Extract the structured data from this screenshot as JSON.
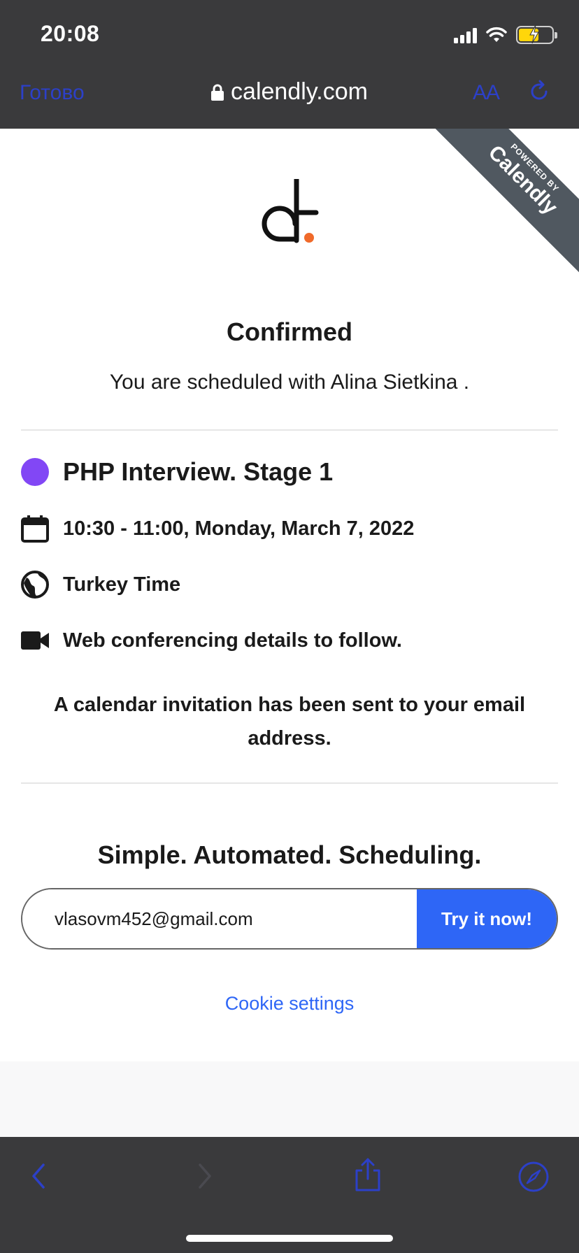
{
  "status_bar": {
    "time": "20:08"
  },
  "browser": {
    "done_label": "Готово",
    "url": "calendly.com",
    "text_size_label": "AA"
  },
  "ribbon": {
    "powered_by": "POWERED BY",
    "brand": "Calendly"
  },
  "confirmation": {
    "title": "Confirmed",
    "subtitle": "You are scheduled with Alina Sietkina ."
  },
  "event": {
    "name": "PHP Interview. Stage 1",
    "color": "#8247f5",
    "datetime": "10:30 - 11:00, Monday, March 7, 2022",
    "timezone": "Turkey Time",
    "location": "Web conferencing details to follow."
  },
  "invitation_note": "A calendar invitation has been sent to your email address.",
  "signup": {
    "tagline": "Simple. Automated. Scheduling.",
    "email_value": "vlasovm452@gmail.com",
    "button_label": "Try it now!"
  },
  "cookie_settings_label": "Cookie settings",
  "colors": {
    "accent": "#2e66f6",
    "toolbar_bg": "#3a3a3c",
    "link_dim": "#2c40c8"
  }
}
